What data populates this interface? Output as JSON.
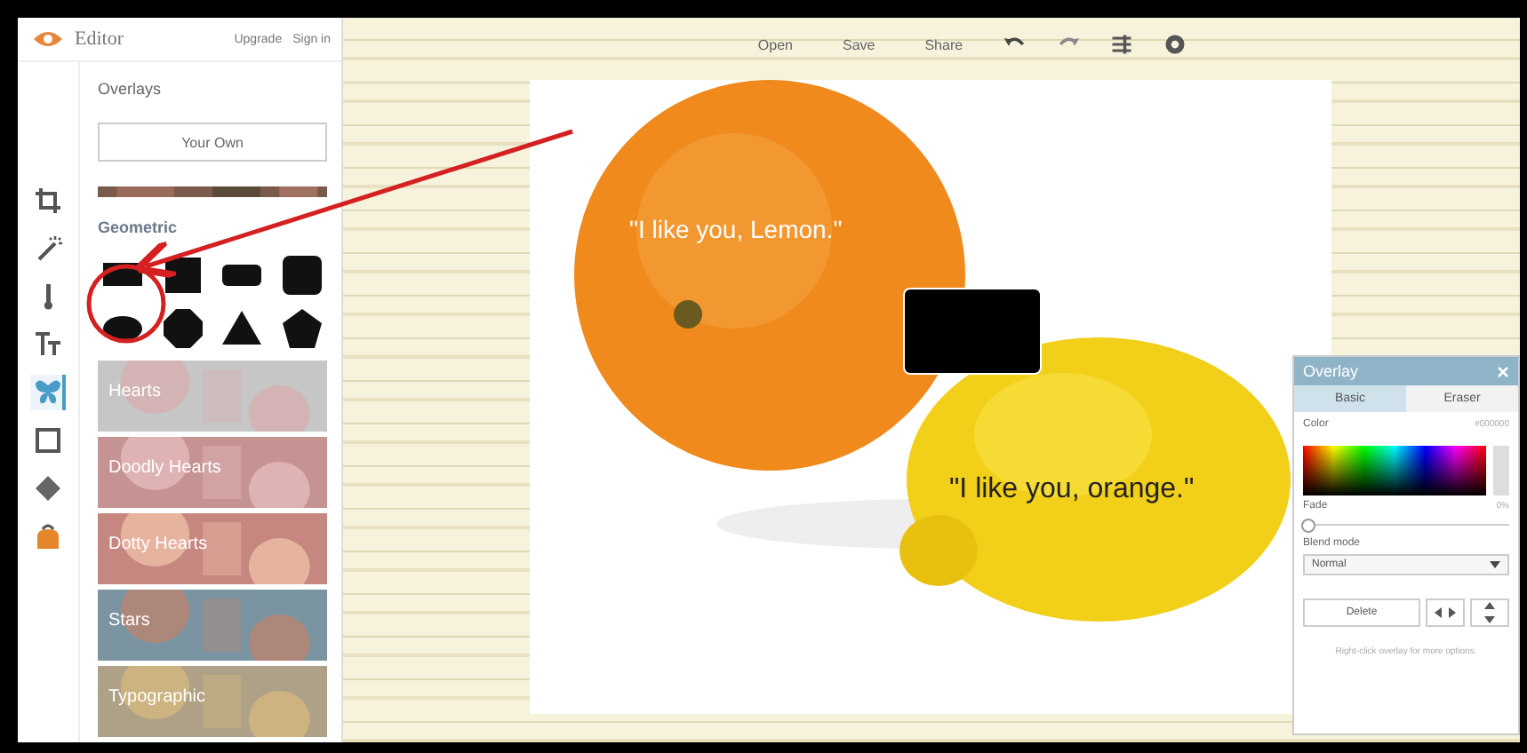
{
  "header": {
    "app_name": "Editor",
    "upgrade": "Upgrade",
    "sign_in": "Sign in"
  },
  "panel": {
    "title": "Overlays",
    "your_own": "Your Own",
    "section_label": "Geometric",
    "categories": [
      {
        "label": "Hearts"
      },
      {
        "label": "Doodly Hearts"
      },
      {
        "label": "Dotty Hearts"
      },
      {
        "label": "Stars"
      },
      {
        "label": "Typographic"
      }
    ]
  },
  "tools": [
    {
      "kind": "crop",
      "selected": false
    },
    {
      "kind": "wand",
      "selected": false
    },
    {
      "kind": "thermometer",
      "selected": false
    },
    {
      "kind": "text",
      "selected": false
    },
    {
      "kind": "butterfly",
      "selected": true
    },
    {
      "kind": "frame",
      "selected": false
    },
    {
      "kind": "diamond",
      "selected": false
    },
    {
      "kind": "bag",
      "selected": false
    }
  ],
  "toolbar": {
    "buttons": [
      "Open",
      "Save",
      "Share"
    ]
  },
  "canvas": {
    "captions": [
      "\"I like you, Lemon.\"",
      "\"I like you, orange.\""
    ]
  },
  "overlay_panel": {
    "title": "Overlay",
    "tabs": [
      {
        "label": "Basic",
        "selected": true
      },
      {
        "label": "Eraser",
        "selected": false
      }
    ],
    "color_label": "Color",
    "color_value": "#000000",
    "fade_label": "Fade",
    "fade_value": "0%",
    "fade": {
      "level": 0
    },
    "blend_label": "Blend mode",
    "blend_value": "Normal",
    "delete": "Delete",
    "hint": "Right-click overlay for more options."
  }
}
